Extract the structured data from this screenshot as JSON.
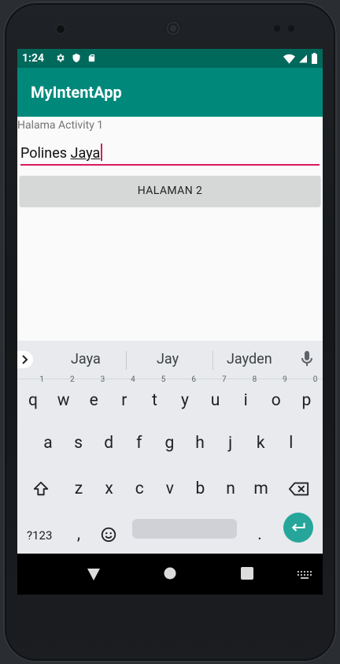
{
  "status": {
    "time": "1:24"
  },
  "app": {
    "title": "MyIntentApp"
  },
  "content": {
    "label": "Halama Activity 1",
    "input_value_prefix": "Polines ",
    "input_value_underlined": "Jaya",
    "button_label": "HALAMAN 2"
  },
  "keyboard": {
    "suggestions": [
      "Jaya",
      "Jay",
      "Jayden"
    ],
    "row1": [
      {
        "k": "q",
        "n": "1"
      },
      {
        "k": "w",
        "n": "2"
      },
      {
        "k": "e",
        "n": "3"
      },
      {
        "k": "r",
        "n": "4"
      },
      {
        "k": "t",
        "n": "5"
      },
      {
        "k": "y",
        "n": "6"
      },
      {
        "k": "u",
        "n": "7"
      },
      {
        "k": "i",
        "n": "8"
      },
      {
        "k": "o",
        "n": "9"
      },
      {
        "k": "p",
        "n": "0"
      }
    ],
    "row2": [
      "a",
      "s",
      "d",
      "f",
      "g",
      "h",
      "j",
      "k",
      "l"
    ],
    "row3": [
      "z",
      "x",
      "c",
      "v",
      "b",
      "n",
      "m"
    ],
    "sym_label": "?123",
    "comma": ",",
    "period": "."
  },
  "colors": {
    "status_bar": "#00695c",
    "app_bar": "#00897b",
    "accent": "#d81b60",
    "enter_key": "#26a69a"
  }
}
